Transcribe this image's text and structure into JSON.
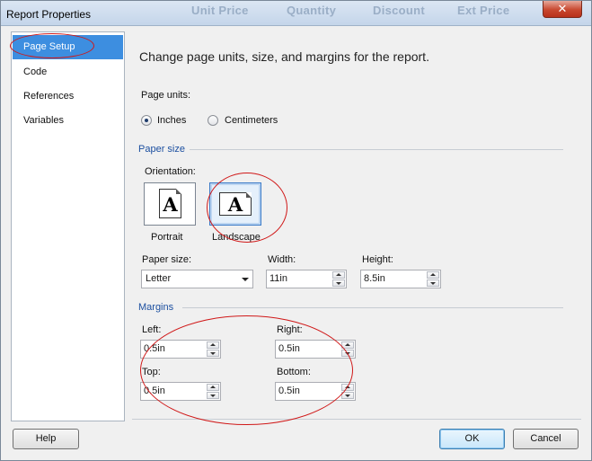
{
  "window": {
    "title": "Report Properties",
    "close_glyph": "✕",
    "background_header_ghost": [
      "Unit Price",
      "Quantity",
      "Discount",
      "Ext Price"
    ]
  },
  "nav": {
    "items": [
      {
        "label": "Page Setup",
        "selected": true
      },
      {
        "label": "Code",
        "selected": false
      },
      {
        "label": "References",
        "selected": false
      },
      {
        "label": "Variables",
        "selected": false
      }
    ]
  },
  "main": {
    "heading": "Change page units, size, and margins for the report.",
    "page_units": {
      "label": "Page units:",
      "options": [
        {
          "label": "Inches",
          "checked": true
        },
        {
          "label": "Centimeters",
          "checked": false
        }
      ]
    },
    "paper_size_section": {
      "title": "Paper size",
      "orientation_label": "Orientation:",
      "portrait": {
        "label": "Portrait",
        "glyph": "A",
        "selected": false
      },
      "landscape": {
        "label": "Landscape",
        "glyph": "A",
        "selected": true
      },
      "paper_size": {
        "label": "Paper size:",
        "value": "Letter"
      },
      "width": {
        "label": "Width:",
        "value": "11in"
      },
      "height": {
        "label": "Height:",
        "value": "8.5in"
      }
    },
    "margins_section": {
      "title": "Margins",
      "left": {
        "label": "Left:",
        "value": "0.5in"
      },
      "right": {
        "label": "Right:",
        "value": "0.5in"
      },
      "top": {
        "label": "Top:",
        "value": "0.5in"
      },
      "bottom": {
        "label": "Bottom:",
        "value": "0.5in"
      }
    }
  },
  "footer": {
    "help_label": "Help",
    "ok_label": "OK",
    "cancel_label": "Cancel"
  },
  "colors": {
    "selection": "#3d8ee0",
    "section_title": "#1c4fa0",
    "annotation": "#d01818"
  }
}
